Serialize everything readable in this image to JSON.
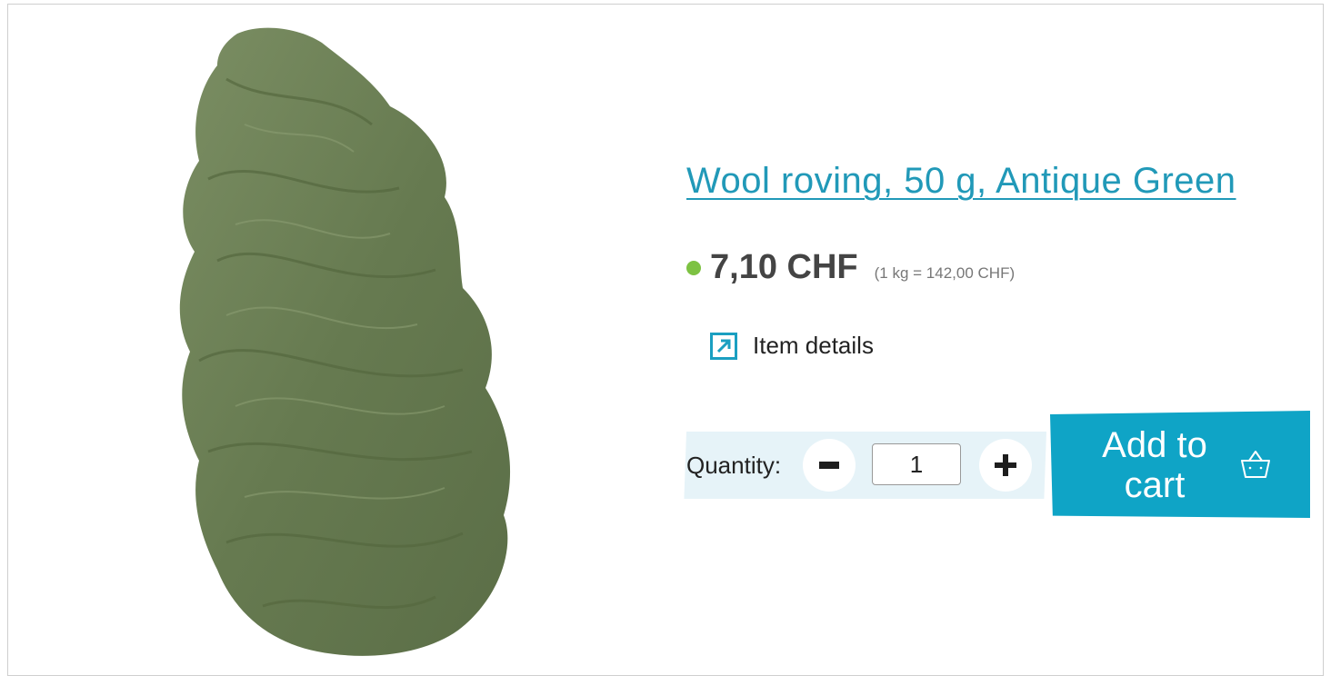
{
  "product": {
    "title": "Wool roving, 50 g, Antique Green",
    "price": "7,10 CHF",
    "unit_price": "(1 kg = 142,00 CHF)",
    "stock_status_color": "#7dc242",
    "image_color": "#6d8056"
  },
  "details_link": {
    "label": "Item details",
    "icon": "external-arrow-icon"
  },
  "quantity": {
    "label": "Quantity:",
    "value": "1",
    "minus_icon": "minus-icon",
    "plus_icon": "plus-icon"
  },
  "cart": {
    "label": "Add to cart",
    "icon": "basket-icon",
    "color": "#0fa4c6"
  },
  "colors": {
    "accent": "#2199b8",
    "panel": "#e6f3f8"
  }
}
